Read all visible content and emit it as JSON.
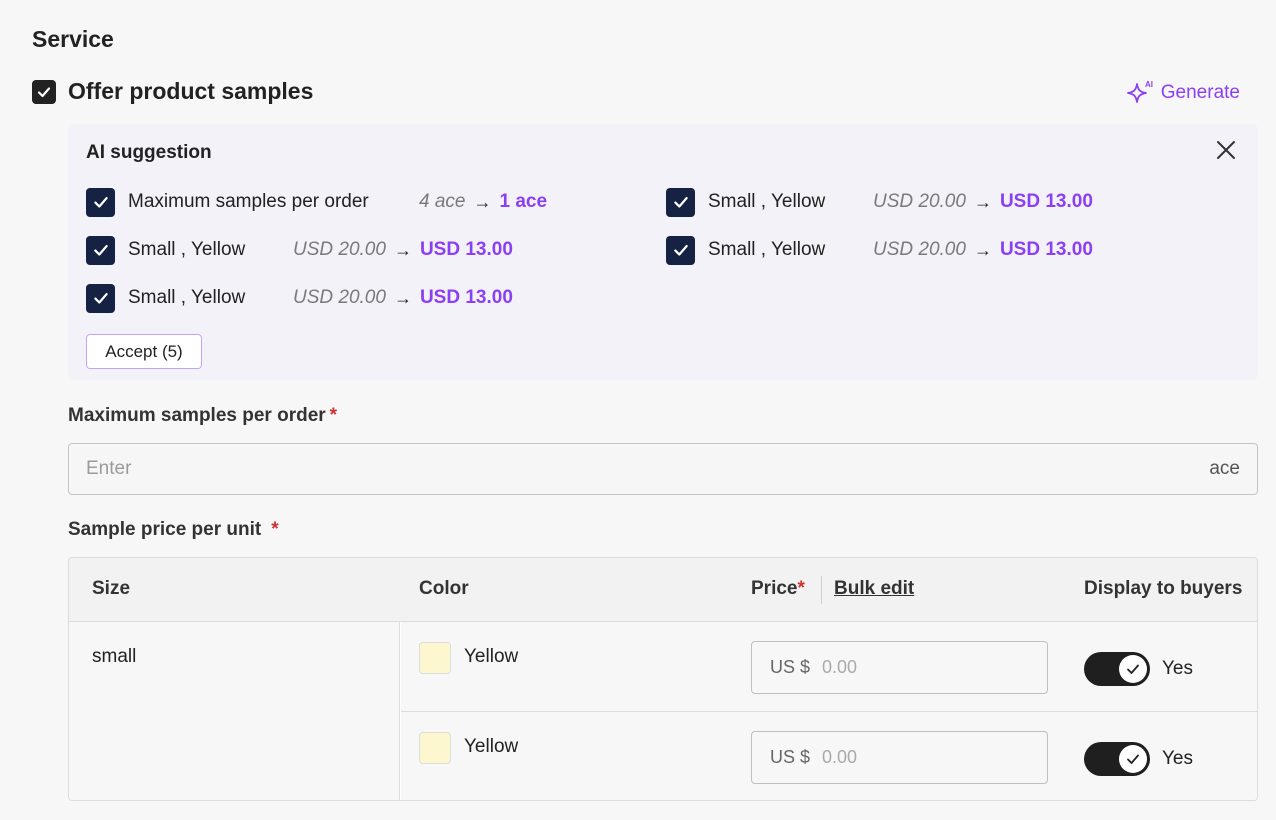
{
  "section": {
    "title": "Service"
  },
  "offer": {
    "label": "Offer product samples",
    "checked": true
  },
  "generate": {
    "label": "Generate",
    "icon": "sparkle-ai-icon",
    "color": "#8b3ff2"
  },
  "ai_suggestion": {
    "title": "AI suggestion",
    "items": [
      {
        "label": "Maximum samples per order",
        "old": "4 ace",
        "new": "1 ace"
      },
      {
        "label": "Small , Yellow",
        "old": "USD 20.00",
        "new": "USD 13.00"
      },
      {
        "label": "Small , Yellow",
        "old": "USD 20.00",
        "new": "USD 13.00"
      },
      {
        "label": "Small , Yellow",
        "old": "USD 20.00",
        "new": "USD 13.00"
      },
      {
        "label": "Small , Yellow",
        "old": "USD 20.00",
        "new": "USD 13.00"
      }
    ],
    "arrow": "→",
    "accept_label": "Accept (5)"
  },
  "max_samples": {
    "label": "Maximum samples per order",
    "required_mark": "*",
    "placeholder": "Enter",
    "unit": "ace"
  },
  "sample_price": {
    "label": "Sample price per unit",
    "required_mark": "*",
    "columns": {
      "size": "Size",
      "color": "Color",
      "price": "Price",
      "price_required": "*",
      "bulk_edit": "Bulk edit",
      "display": "Display to buyers"
    },
    "size_value": "small",
    "rows": [
      {
        "color": "Yellow",
        "swatch": "#fdf7cf",
        "currency_prefix": "US $",
        "price_placeholder": "0.00",
        "display": "Yes"
      },
      {
        "color": "Yellow",
        "swatch": "#fdf7cf",
        "currency_prefix": "US $",
        "price_placeholder": "0.00",
        "display": "Yes"
      }
    ]
  }
}
